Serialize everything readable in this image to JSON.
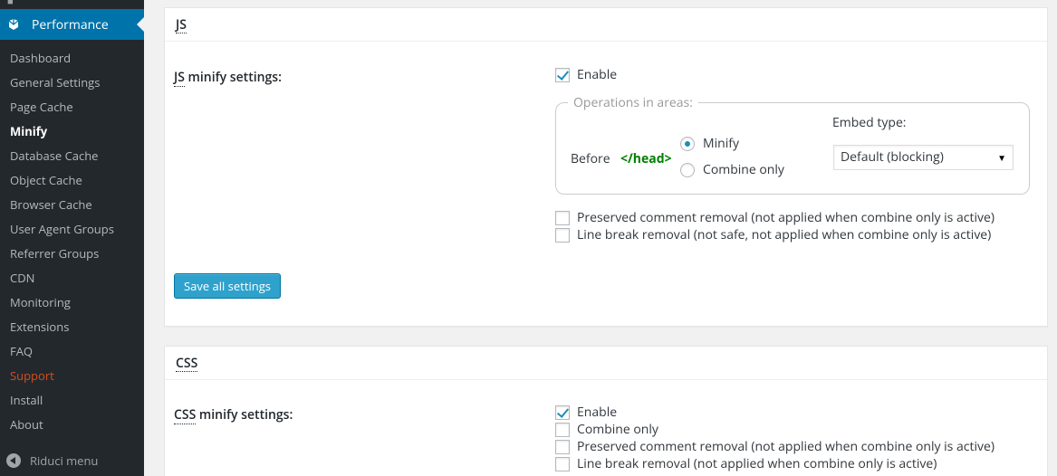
{
  "sidebar": {
    "menu_title": "Performance",
    "items": [
      {
        "label": "Dashboard"
      },
      {
        "label": "General Settings"
      },
      {
        "label": "Page Cache"
      },
      {
        "label": "Minify"
      },
      {
        "label": "Database Cache"
      },
      {
        "label": "Object Cache"
      },
      {
        "label": "Browser Cache"
      },
      {
        "label": "User Agent Groups"
      },
      {
        "label": "Referrer Groups"
      },
      {
        "label": "CDN"
      },
      {
        "label": "Monitoring"
      },
      {
        "label": "Extensions"
      },
      {
        "label": "FAQ"
      },
      {
        "label": "Support"
      },
      {
        "label": "Install"
      },
      {
        "label": "About"
      }
    ],
    "current_item": "Minify",
    "collapse_label": "Riduci menu"
  },
  "js_panel": {
    "title": "JS",
    "setting_abbr": "JS",
    "setting_rest": " minify settings:",
    "enable_label": "Enable",
    "enable_checked": true,
    "operations_legend": "Operations in areas:",
    "embed_type_label": "Embed type:",
    "before_label": "Before",
    "head_tag": "</head>",
    "radio_minify": "Minify",
    "radio_combine": "Combine only",
    "radio_selected": "Minify",
    "embed_type_value": "Default (blocking)",
    "preserved_comment_label": "Preserved comment removal (not applied when combine only is active)",
    "line_break_label": "Line break removal (not safe, not applied when combine only is active)",
    "save_button": "Save all settings"
  },
  "css_panel": {
    "title": "CSS",
    "setting_abbr": "CSS",
    "setting_rest": " minify settings:",
    "enable_label": "Enable",
    "enable_checked": true,
    "combine_only_label": "Combine only",
    "preserved_comment_label": "Preserved comment removal (not applied when combine only is active)",
    "line_break_label": "Line break removal (not applied when combine only is active)"
  },
  "colors": {
    "sidebar_bg": "#23282d",
    "active_menu": "#0073aa",
    "support": "#d54e21",
    "head_tag": "#008000",
    "button": "#2ea2cc"
  }
}
